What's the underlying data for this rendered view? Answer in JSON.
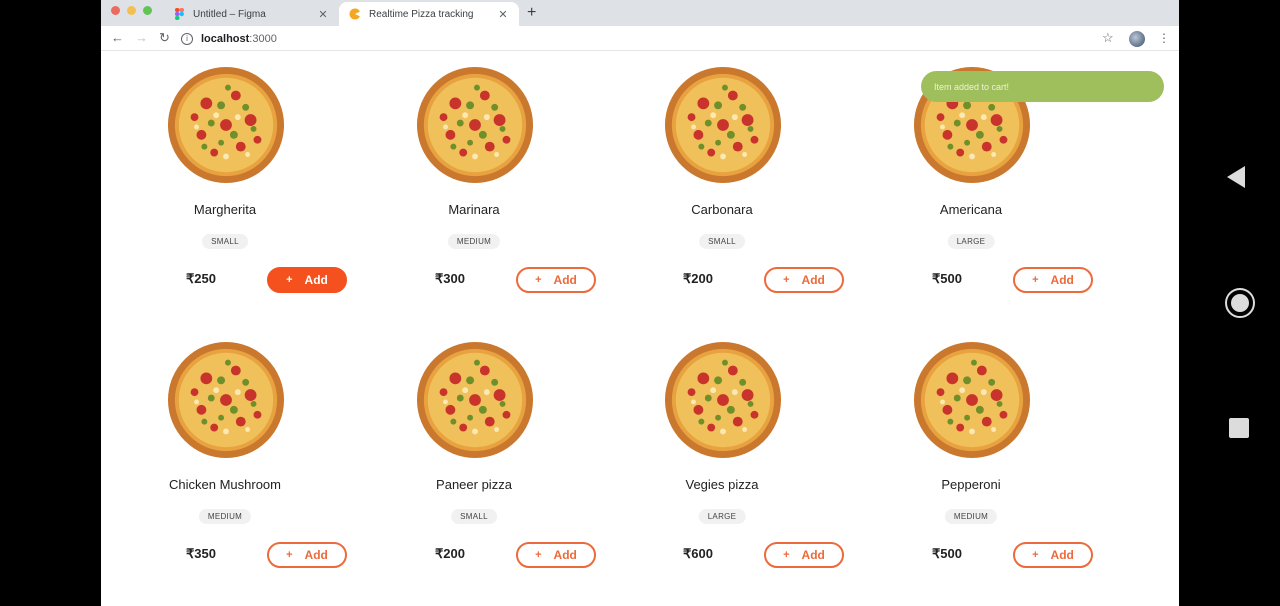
{
  "browser": {
    "tabs": [
      {
        "title": "Untitled – Figma",
        "icon": "figma-icon"
      },
      {
        "title": "Realtime Pizza tracking",
        "icon": "pizza-favicon"
      }
    ],
    "close_glyph": "✕",
    "new_tab_glyph": "+",
    "address": {
      "host": "localhost",
      "port": ":3000"
    }
  },
  "toast": {
    "message": "Item added to cart!",
    "color": "#9fbe5c"
  },
  "menu": [
    {
      "name": "Margherita",
      "size": "SMALL",
      "price": "₹250",
      "add_label": "Add"
    },
    {
      "name": "Marinara",
      "size": "MEDIUM",
      "price": "₹300",
      "add_label": "Add"
    },
    {
      "name": "Carbonara",
      "size": "SMALL",
      "price": "₹200",
      "add_label": "Add"
    },
    {
      "name": "Americana",
      "size": "LARGE",
      "price": "₹500",
      "add_label": "Add"
    },
    {
      "name": "Chicken Mushroom",
      "size": "MEDIUM",
      "price": "₹350",
      "add_label": "Add"
    },
    {
      "name": "Paneer pizza",
      "size": "SMALL",
      "price": "₹200",
      "add_label": "Add"
    },
    {
      "name": "Vegies pizza",
      "size": "LARGE",
      "price": "₹600",
      "add_label": "Add"
    },
    {
      "name": "Pepperoni",
      "size": "MEDIUM",
      "price": "₹500",
      "add_label": "Add"
    }
  ],
  "colors": {
    "accent": "#f4511e",
    "button_outline": "#ec6a3b"
  }
}
